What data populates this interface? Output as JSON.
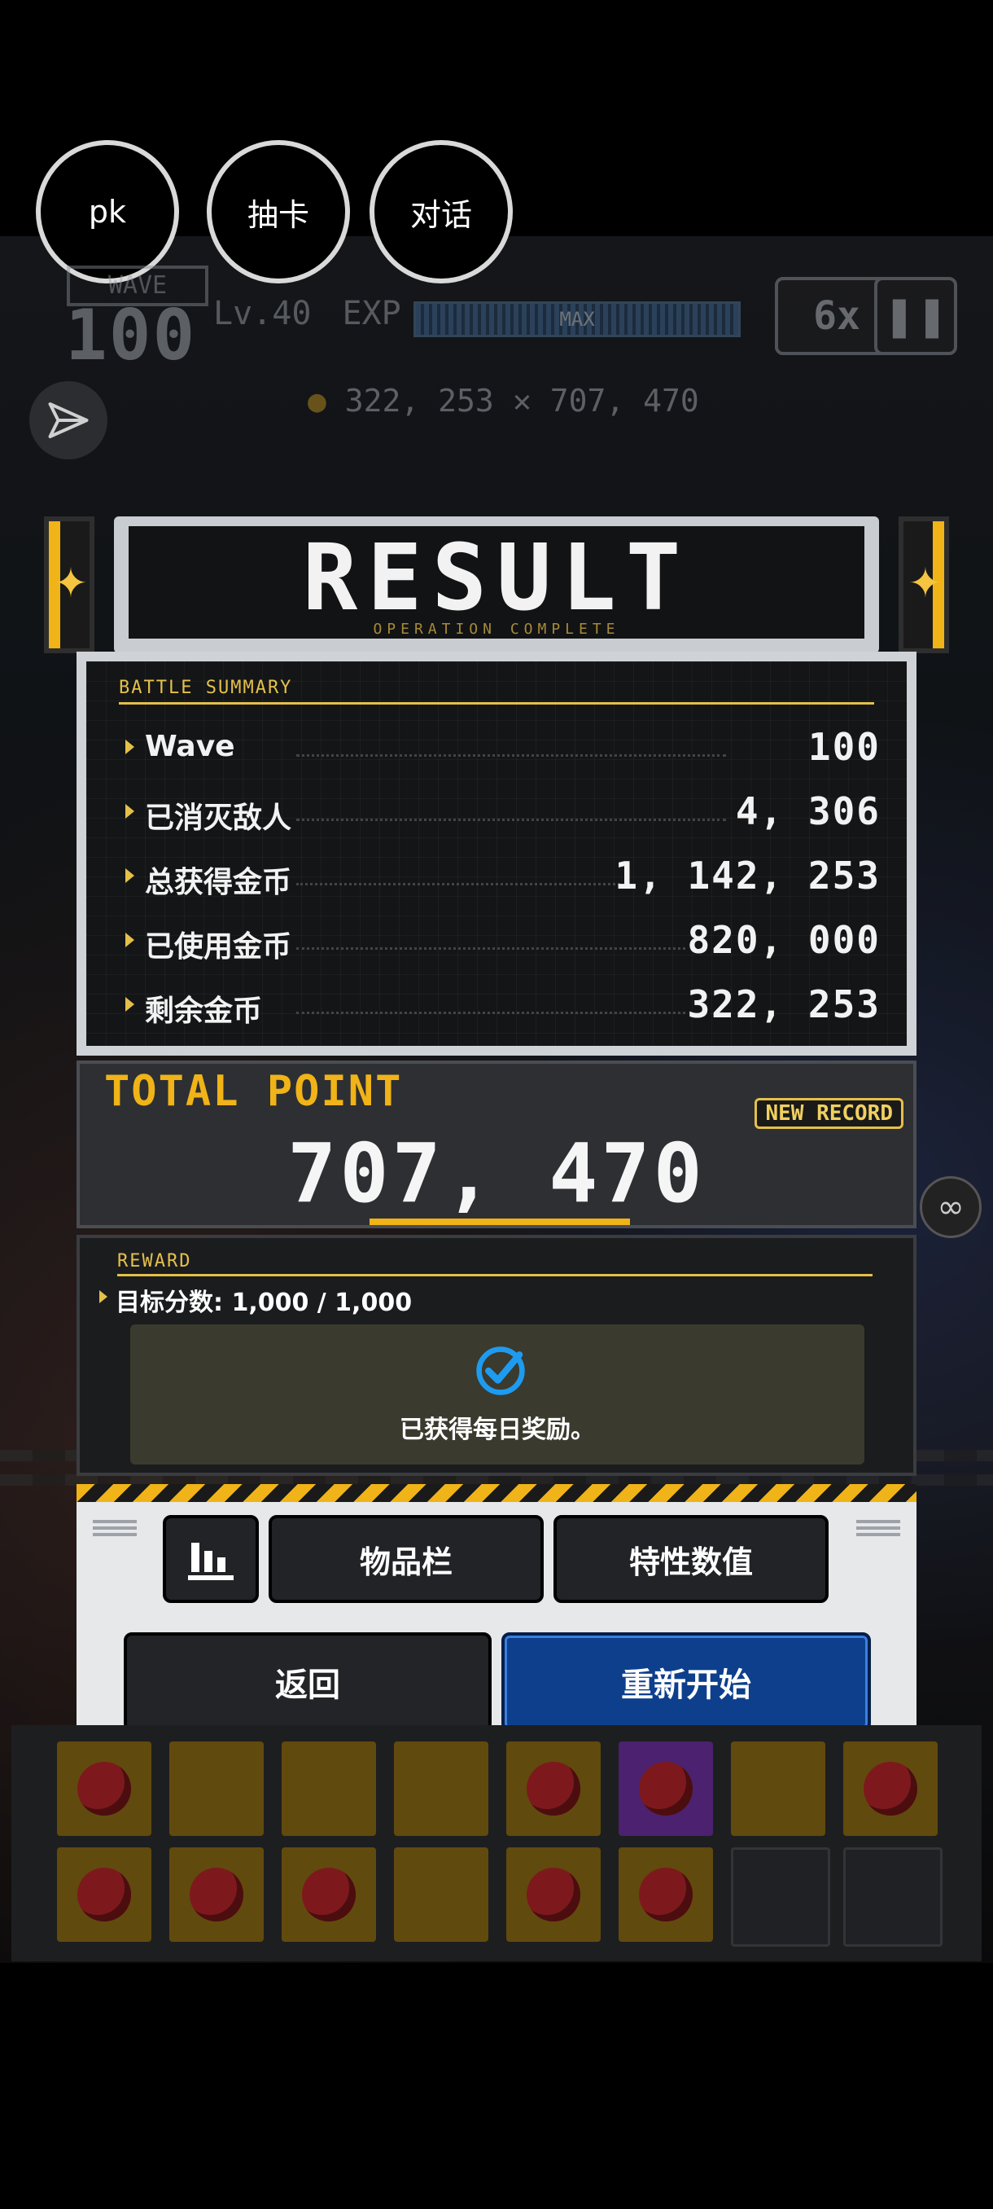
{
  "chips": [
    "pk",
    "抽卡",
    "对话"
  ],
  "hud": {
    "wave_label": "WAVE",
    "wave": "100",
    "level": "Lv.40",
    "exp_label": "EXP",
    "exp_max": "MAX",
    "exp_fill": 1.0,
    "speed": "6x",
    "pause_icon": "pause-icon",
    "gold": "322, 253",
    "points": "707, 470"
  },
  "result": {
    "title": "RESULT",
    "subtitle": "OPERATION COMPLETE"
  },
  "summary": {
    "label": "BATTLE SUMMARY",
    "rows": [
      {
        "label": "Wave",
        "value": "100"
      },
      {
        "label": "已消灭敌人",
        "value": "4, 306"
      },
      {
        "label": "总获得金币",
        "value": "1, 142, 253"
      },
      {
        "label": "已使用金币",
        "value": "820, 000"
      },
      {
        "label": "剩余金币",
        "value": "322, 253"
      }
    ]
  },
  "total": {
    "label": "TOTAL POINT",
    "badge": "NEW RECORD",
    "value": "707, 470"
  },
  "reward": {
    "label": "REWARD",
    "goal": "目标分数:  1,000 / 1,000",
    "status": "已获得每日奖励。"
  },
  "controls": {
    "stats_icon": "bar-chart-icon",
    "inventory": "物品栏",
    "traits": "特性数值",
    "back": "返回",
    "restart": "重新开始"
  },
  "colors": {
    "accent_yellow": "#f0b318",
    "restart_blue": "#0d3f8c",
    "check_blue": "#1e9bf0"
  }
}
